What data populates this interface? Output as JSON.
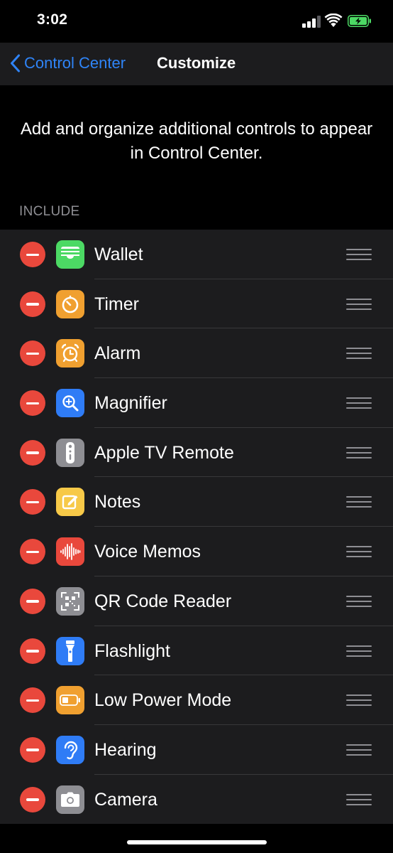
{
  "status_bar": {
    "time": "3:02",
    "signal_bars_active": 3,
    "signal_bars_total": 4,
    "battery_state": "charging",
    "battery_color": "#4cd964"
  },
  "nav": {
    "back_label": "Control Center",
    "title": "Customize",
    "accent_color": "#2f84f7"
  },
  "description": "Add and organize additional controls to appear in Control Center.",
  "section_header": "INCLUDE",
  "controls": [
    {
      "label": "Wallet",
      "icon": "wallet-icon",
      "color": "#4cd964"
    },
    {
      "label": "Timer",
      "icon": "timer-icon",
      "color": "#f0a030"
    },
    {
      "label": "Alarm",
      "icon": "alarm-icon",
      "color": "#f0a030"
    },
    {
      "label": "Magnifier",
      "icon": "magnifier-icon",
      "color": "#2f7cf6"
    },
    {
      "label": "Apple TV Remote",
      "icon": "apple-tv-remote-icon",
      "color": "#8e8e93"
    },
    {
      "label": "Notes",
      "icon": "notes-icon",
      "color": "#f7c948"
    },
    {
      "label": "Voice Memos",
      "icon": "voice-memos-icon",
      "color": "#e9483c"
    },
    {
      "label": "QR Code Reader",
      "icon": "qr-code-icon",
      "color": "#8e8e93"
    },
    {
      "label": "Flashlight",
      "icon": "flashlight-icon",
      "color": "#2f7cf6"
    },
    {
      "label": "Low Power Mode",
      "icon": "low-power-mode-icon",
      "color": "#f0a030"
    },
    {
      "label": "Hearing",
      "icon": "hearing-icon",
      "color": "#2f7cf6"
    },
    {
      "label": "Camera",
      "icon": "camera-icon",
      "color": "#8e8e93"
    }
  ]
}
